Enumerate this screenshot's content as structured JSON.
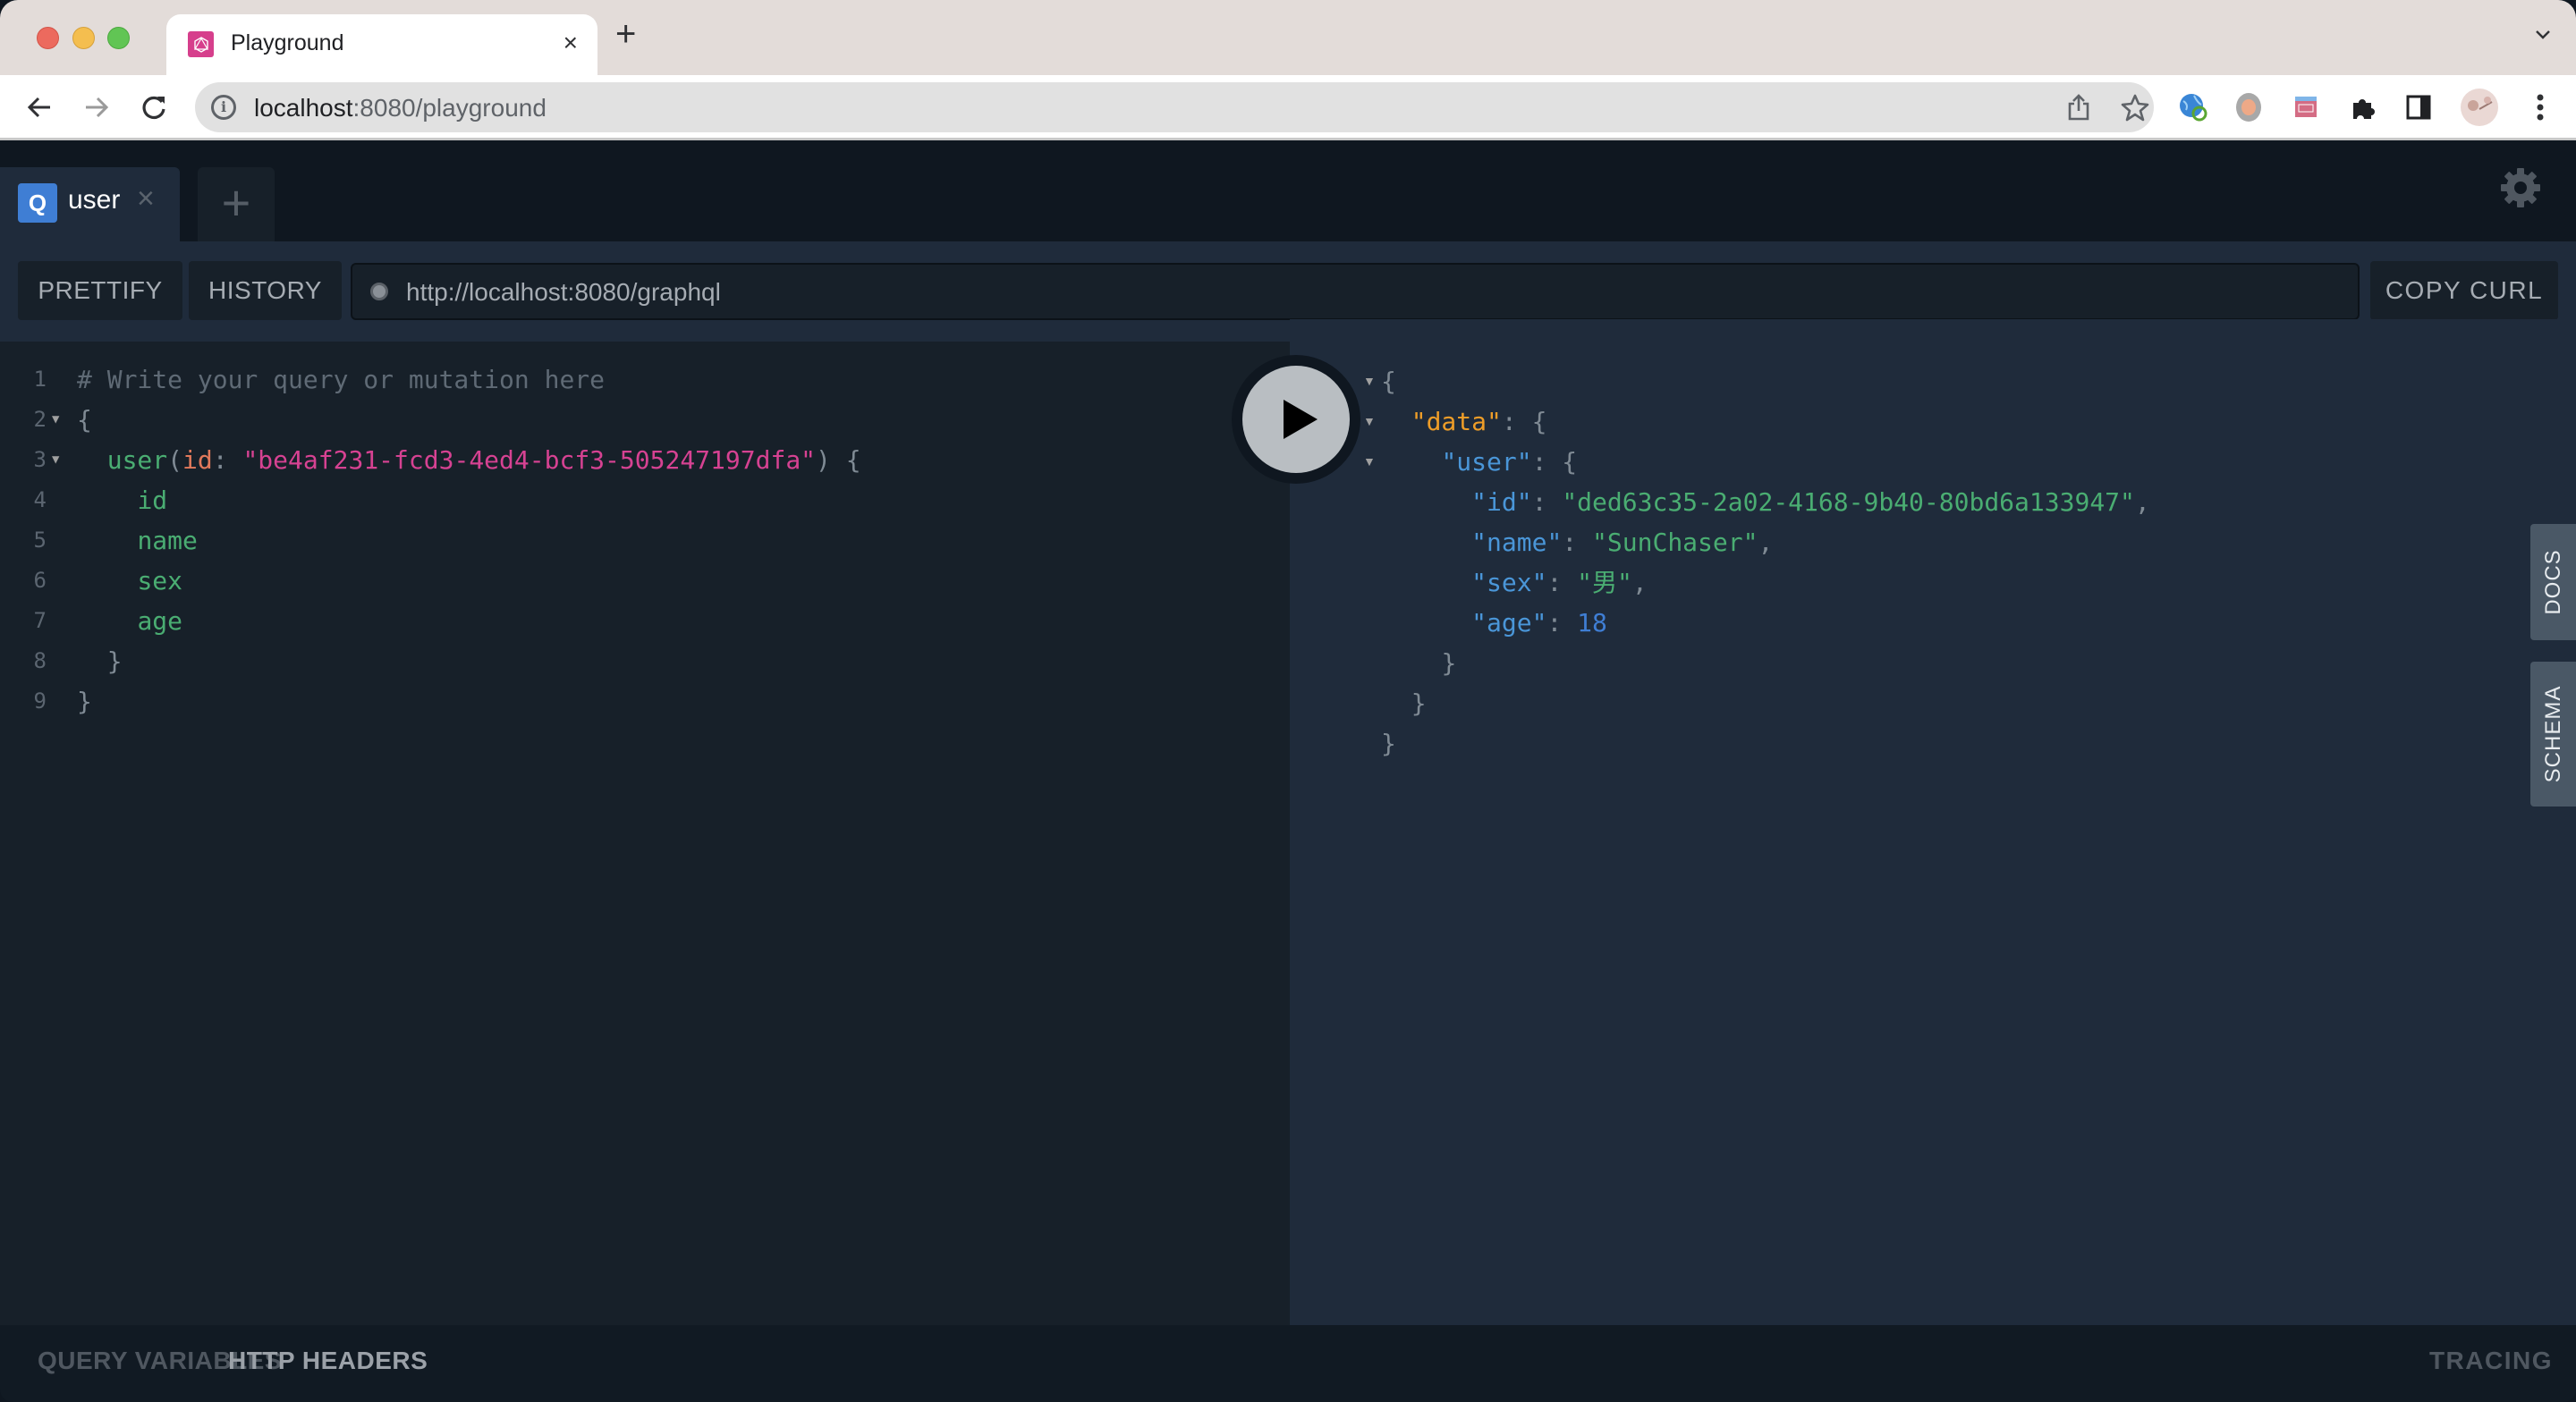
{
  "browser": {
    "tab_title": "Playground",
    "tab_close": "×",
    "new_tab": "+",
    "url_host": "localhost",
    "url_path": ":8080/playground"
  },
  "playground": {
    "tabs": [
      {
        "badge": "Q",
        "title": "user",
        "close": "×"
      }
    ],
    "add_tab": "+",
    "toolbar": {
      "prettify": "PRETTIFY",
      "history": "HISTORY",
      "endpoint": "http://localhost:8080/graphql",
      "copy_curl": "COPY CURL"
    },
    "editor": {
      "lines": [
        {
          "n": "1",
          "fold": "",
          "indent": "",
          "tokens": [
            {
              "t": "# Write your query or mutation here",
              "c": "c-comment"
            }
          ]
        },
        {
          "n": "2",
          "fold": "▼",
          "indent": "",
          "tokens": [
            {
              "t": "{",
              "c": "c-punct"
            }
          ]
        },
        {
          "n": "3",
          "fold": "▼",
          "indent": "  ",
          "tokens": [
            {
              "t": "user",
              "c": "c-field"
            },
            {
              "t": "(",
              "c": "c-punct"
            },
            {
              "t": "id",
              "c": "c-arg"
            },
            {
              "t": ": ",
              "c": "c-punct"
            },
            {
              "t": "\"be4af231-fcd3-4ed4-bcf3-505247197dfa\"",
              "c": "c-string"
            },
            {
              "t": ") {",
              "c": "c-punct"
            }
          ]
        },
        {
          "n": "4",
          "fold": "",
          "indent": "    ",
          "tokens": [
            {
              "t": "id",
              "c": "c-field"
            }
          ]
        },
        {
          "n": "5",
          "fold": "",
          "indent": "    ",
          "tokens": [
            {
              "t": "name",
              "c": "c-field"
            }
          ]
        },
        {
          "n": "6",
          "fold": "",
          "indent": "    ",
          "tokens": [
            {
              "t": "sex",
              "c": "c-field"
            }
          ]
        },
        {
          "n": "7",
          "fold": "",
          "indent": "    ",
          "tokens": [
            {
              "t": "age",
              "c": "c-field"
            }
          ]
        },
        {
          "n": "8",
          "fold": "",
          "indent": "  ",
          "tokens": [
            {
              "t": "}",
              "c": "c-punct"
            }
          ]
        },
        {
          "n": "9",
          "fold": "",
          "indent": "",
          "tokens": [
            {
              "t": "}",
              "c": "c-punct"
            }
          ]
        }
      ]
    },
    "result": {
      "lines": [
        {
          "fold": "▼",
          "indent": "",
          "tokens": [
            {
              "t": "{",
              "c": "r-punct"
            }
          ]
        },
        {
          "fold": "▼",
          "indent": "  ",
          "tokens": [
            {
              "t": "\"data\"",
              "c": "r-key-data"
            },
            {
              "t": ": {",
              "c": "r-punct"
            }
          ]
        },
        {
          "fold": "▼",
          "indent": "    ",
          "tokens": [
            {
              "t": "\"user\"",
              "c": "r-key"
            },
            {
              "t": ": {",
              "c": "r-punct"
            }
          ]
        },
        {
          "fold": "",
          "indent": "      ",
          "tokens": [
            {
              "t": "\"id\"",
              "c": "r-key"
            },
            {
              "t": ": ",
              "c": "r-punct"
            },
            {
              "t": "\"ded63c35-2a02-4168-9b40-80bd6a133947\"",
              "c": "r-str"
            },
            {
              "t": ",",
              "c": "r-punct"
            }
          ]
        },
        {
          "fold": "",
          "indent": "      ",
          "tokens": [
            {
              "t": "\"name\"",
              "c": "r-key"
            },
            {
              "t": ": ",
              "c": "r-punct"
            },
            {
              "t": "\"SunChaser\"",
              "c": "r-str"
            },
            {
              "t": ",",
              "c": "r-punct"
            }
          ]
        },
        {
          "fold": "",
          "indent": "      ",
          "tokens": [
            {
              "t": "\"sex\"",
              "c": "r-key"
            },
            {
              "t": ": ",
              "c": "r-punct"
            },
            {
              "t": "\"男\"",
              "c": "r-str"
            },
            {
              "t": ",",
              "c": "r-punct"
            }
          ]
        },
        {
          "fold": "",
          "indent": "      ",
          "tokens": [
            {
              "t": "\"age\"",
              "c": "r-key"
            },
            {
              "t": ": ",
              "c": "r-punct"
            },
            {
              "t": "18",
              "c": "r-num"
            }
          ]
        },
        {
          "fold": "",
          "indent": "    ",
          "tokens": [
            {
              "t": "}",
              "c": "r-punct"
            }
          ]
        },
        {
          "fold": "",
          "indent": "  ",
          "tokens": [
            {
              "t": "}",
              "c": "r-punct"
            }
          ]
        },
        {
          "fold": "",
          "indent": "",
          "tokens": [
            {
              "t": "}",
              "c": "r-punct"
            }
          ]
        }
      ]
    },
    "side_tabs": {
      "docs": "DOCS",
      "schema": "SCHEMA"
    },
    "bottom": {
      "query_variables": "QUERY VARIABLES",
      "http_headers": "HTTP HEADERS",
      "tracing": "TRACING"
    },
    "colors": {
      "accent": "#3f7ed4",
      "string": "#d64292",
      "field": "#4aad72",
      "json_data_key": "#ee9d28"
    }
  }
}
